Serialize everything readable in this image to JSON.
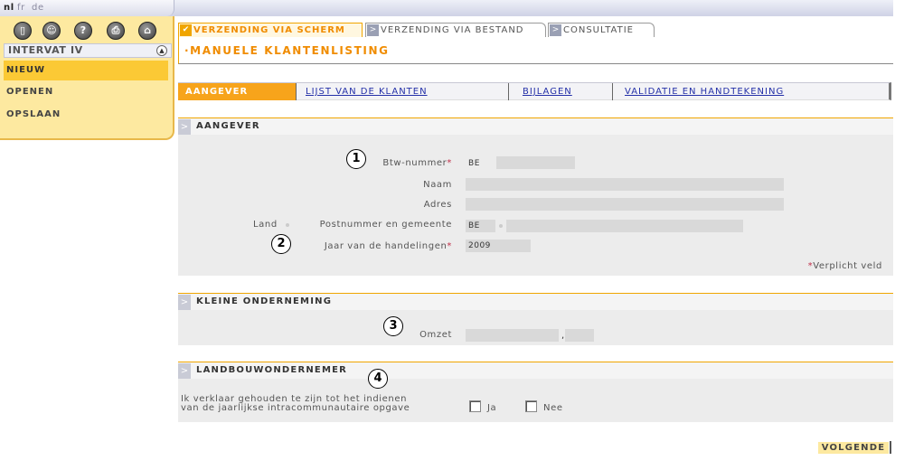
{
  "languages": [
    {
      "code": "nl",
      "active": true
    },
    {
      "code": "fr",
      "active": false
    },
    {
      "code": "de",
      "active": false
    }
  ],
  "toolbar_icons": [
    "door-icon",
    "user-icon",
    "help-icon",
    "print-icon",
    "home-icon"
  ],
  "toolbar_glyphs": [
    "▯",
    "☺",
    "?",
    "⎙",
    "⌂"
  ],
  "app_title": "INTERVAT IV",
  "menu": {
    "new": "NIEUW",
    "open": "OPENEN",
    "save": "OPSLAAN"
  },
  "top_tabs": {
    "screen": "VERZENDING VIA SCHERM",
    "file": "VERZENDING VIA BESTAND",
    "consult": "CONSULTATIE"
  },
  "page_title": "·MANUELE KLANTENLISTING",
  "sub_tabs": {
    "aangever": "AANGEVER",
    "lijst": "LIJST VAN DE KLANTEN",
    "bijlagen": "BIJLAGEN",
    "validatie": "VALIDATIE EN HANDTEKENING"
  },
  "section_aangever": {
    "title": "AANGEVER",
    "vat_label": "Btw-nummer",
    "vat_prefix": "BE",
    "vat_value": "",
    "name_label": "Naam",
    "name_value": "",
    "address_label": "Adres",
    "address_value": "",
    "land_label": "Land",
    "postal_label": "Postnummer en gemeente",
    "country_value": "BE",
    "postal_value": "",
    "year_label": "Jaar van de handelingen",
    "year_value": "2009",
    "required_note": "Verplicht veld",
    "required_mark": "*"
  },
  "section_small": {
    "title": "KLEINE ONDERNEMING",
    "turnover_label": "Omzet",
    "turnover_int": "",
    "decimal_sep": ",",
    "turnover_dec": ""
  },
  "section_farmer": {
    "title": "LANDBOUWONDERNEMER",
    "statement_line1": "Ik verklaar gehouden te zijn tot het indienen",
    "statement_line2": "van de jaarlijkse intracommunautaire opgave",
    "yes_label": "Ja",
    "no_label": "Nee",
    "yes_checked": false,
    "no_checked": false
  },
  "callouts": [
    "1",
    "2",
    "3",
    "4"
  ],
  "next_label": "VOLGENDE",
  "colors": {
    "accent": "#f0a500",
    "active_tab": "#f7a41b",
    "panel": "#fde9a0",
    "link": "#2430a8",
    "required": "#c0304a"
  }
}
